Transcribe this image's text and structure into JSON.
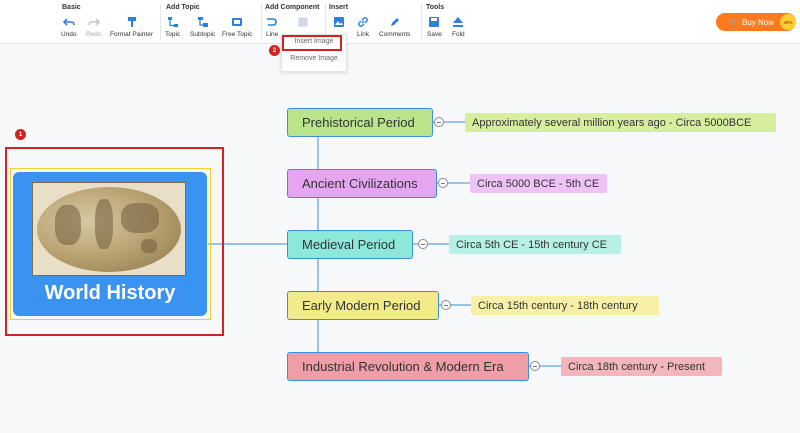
{
  "toolbar": {
    "groups": {
      "basic": "Basic",
      "add_topic": "Add Topic",
      "add_component": "Add Component",
      "insert": "Insert",
      "tools": "Tools"
    },
    "tools": {
      "undo": "Undo",
      "redo": "Redo",
      "format_painter": "Format Painter",
      "topic": "Topic",
      "subtopic": "Subtopic",
      "free_topic": "Free Topic",
      "line": "Line",
      "image": "Image",
      "link": "Link",
      "comments": "Comments",
      "save": "Save",
      "fold": "Fold"
    },
    "buy_now": "Buy Now",
    "buy_badge": "40%"
  },
  "image_menu": {
    "items": [
      "Insert Image",
      "Remove Image"
    ]
  },
  "markers": [
    "1",
    "2"
  ],
  "mindmap": {
    "root": "World History",
    "topics": [
      {
        "label": "Prehistorical Period",
        "detail": "Approximately several million years ago - Circa 5000BCE",
        "color": "#b9e48c",
        "detail_color": "#d7ee9f"
      },
      {
        "label": "Ancient Civilizations",
        "detail": "Circa 5000 BCE - 5th CE",
        "color": "#e5a5f1",
        "detail_color": "#efc3f6"
      },
      {
        "label": "Medieval Period",
        "detail": "Circa 5th CE - 15th century CE",
        "color": "#8ee8da",
        "detail_color": "#b6f0e6"
      },
      {
        "label": "Early Modern Period",
        "detail": "Circa 15th century - 18th century",
        "color": "#f3eb8a",
        "detail_color": "#f7f1a8"
      },
      {
        "label": "Industrial Revolution & Modern Era",
        "detail": "Circa 18th century - Present",
        "color": "#ee9ea6",
        "detail_color": "#f2b6bc"
      }
    ]
  },
  "colors": {
    "root": "#3a93f0",
    "accent_red": "#d22222",
    "buy_now": "#ff7a1a",
    "toolbar_icon": "#2d7fe0"
  }
}
